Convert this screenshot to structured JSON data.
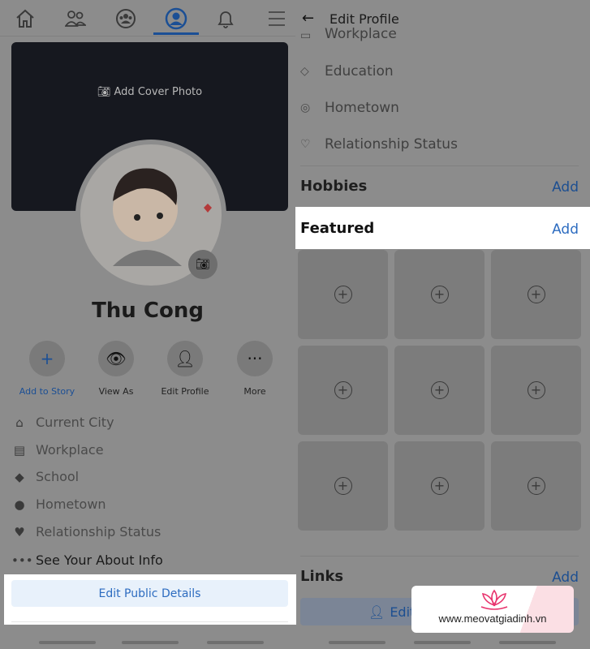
{
  "left": {
    "tabs": [
      "home-icon",
      "friends-icon",
      "groups-icon",
      "profile-icon",
      "bell-icon",
      "menu-icon"
    ],
    "active_tab": "profile-icon",
    "cover_label": "Add Cover Photo",
    "profile_name": "Thu Cong",
    "actions": [
      {
        "label": "Add to Story",
        "icon": "+"
      },
      {
        "label": "View As",
        "icon": "eye"
      },
      {
        "label": "Edit Profile",
        "icon": "person-edit"
      },
      {
        "label": "More",
        "icon": "···"
      }
    ],
    "info": [
      {
        "icon": "⌂",
        "label": "Current City"
      },
      {
        "icon": "▤",
        "label": "Workplace"
      },
      {
        "icon": "◆",
        "label": "School"
      },
      {
        "icon": "●",
        "label": "Hometown"
      },
      {
        "icon": "♥",
        "label": "Relationship Status"
      }
    ],
    "see_about": "See Your About Info",
    "edit_public": "Edit Public Details"
  },
  "right": {
    "back": "←",
    "title": "Edit Profile",
    "rows": [
      {
        "icon": "▭",
        "label": "Workplace"
      },
      {
        "icon": "◇",
        "label": "Education"
      },
      {
        "icon": "◎",
        "label": "Hometown"
      },
      {
        "icon": "♡",
        "label": "Relationship Status"
      }
    ],
    "hobbies": "Hobbies",
    "featured": "Featured",
    "links": "Links",
    "add": "Add",
    "edit_btn": "Edit"
  },
  "watermark": "www.meovatgiadinh.vn",
  "colors": {
    "accent": "#1b4f95",
    "watermark": "#e8336d"
  }
}
